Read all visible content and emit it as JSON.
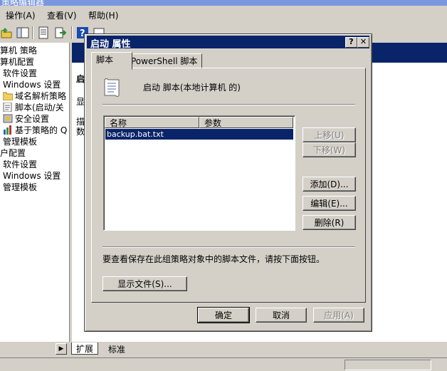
{
  "app": {
    "title": "策略编辑器"
  },
  "menu": {
    "items": [
      "操作(A)",
      "查看(V)",
      "帮助(H)"
    ]
  },
  "tree": {
    "items": [
      "算机 策略",
      "算机配置",
      "软件设置",
      "Windows 设置",
      "域名解析策略",
      "脚本(启动/关",
      "安全设置",
      "基于策略的 Q",
      "管理模板",
      "户配置",
      "软件设置",
      "Windows 设置",
      "管理模板"
    ]
  },
  "rightpane": {
    "heading": "启",
    "line1": "显",
    "line2a": "描",
    "line2b": "数"
  },
  "bottom_tabs": {
    "tab1": "扩展",
    "tab2": "标准"
  },
  "dialog": {
    "title": "启动 属性",
    "help_label": "?",
    "close_label": "✕",
    "tabs": [
      "脚本",
      "PowerShell 脚本"
    ],
    "heading": "启动 脚本(本地计算机 的)",
    "columns": [
      "名称",
      "参数"
    ],
    "scripts": [
      {
        "name": "backup.bat.txt",
        "params": ""
      }
    ],
    "buttons": {
      "move_up": "上移(U)",
      "move_down": "下移(W)",
      "add": "添加(D)...",
      "edit": "编辑(E)...",
      "remove": "删除(R)",
      "show_files": "显示文件(S)...",
      "ok": "确定",
      "cancel": "取消",
      "apply": "应用(A)"
    },
    "info": "要查看保存在此组策略对象中的脚本文件，请按下面按钮。"
  }
}
